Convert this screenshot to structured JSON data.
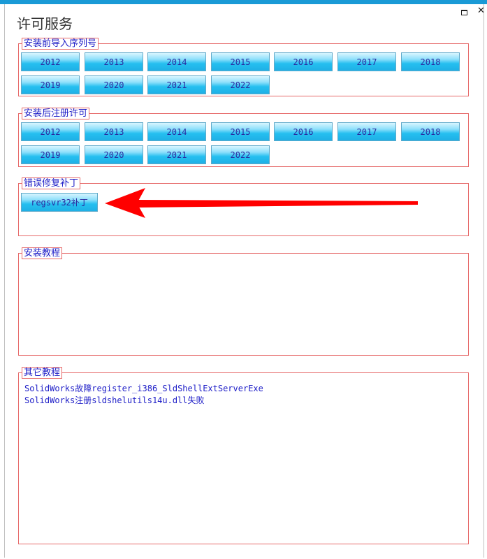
{
  "window": {
    "title": "许可服务",
    "maximize_icon": "maximize-icon",
    "close_glyph": "✕"
  },
  "groups": {
    "serial": {
      "legend": "安装前导入序列号",
      "years": [
        "2012",
        "2013",
        "2014",
        "2015",
        "2016",
        "2017",
        "2018",
        "2019",
        "2020",
        "2021",
        "2022"
      ]
    },
    "license": {
      "legend": "安装后注册许可",
      "years": [
        "2012",
        "2013",
        "2014",
        "2015",
        "2016",
        "2017",
        "2018",
        "2019",
        "2020",
        "2021",
        "2022"
      ]
    },
    "fix": {
      "legend": "错误修复补丁",
      "button": "regsvr32补丁"
    },
    "install": {
      "legend": "安装教程"
    },
    "other": {
      "legend": "其它教程",
      "links": [
        "SolidWorks故障register_i386_SldShellExtServerExe",
        "SolidWorks注册sldshelutils14u.dll失败"
      ]
    }
  },
  "colors": {
    "accent": "#1a9ad6",
    "group_border": "#e66a6a",
    "label_text": "#2020c8",
    "arrow": "#ff0000"
  }
}
